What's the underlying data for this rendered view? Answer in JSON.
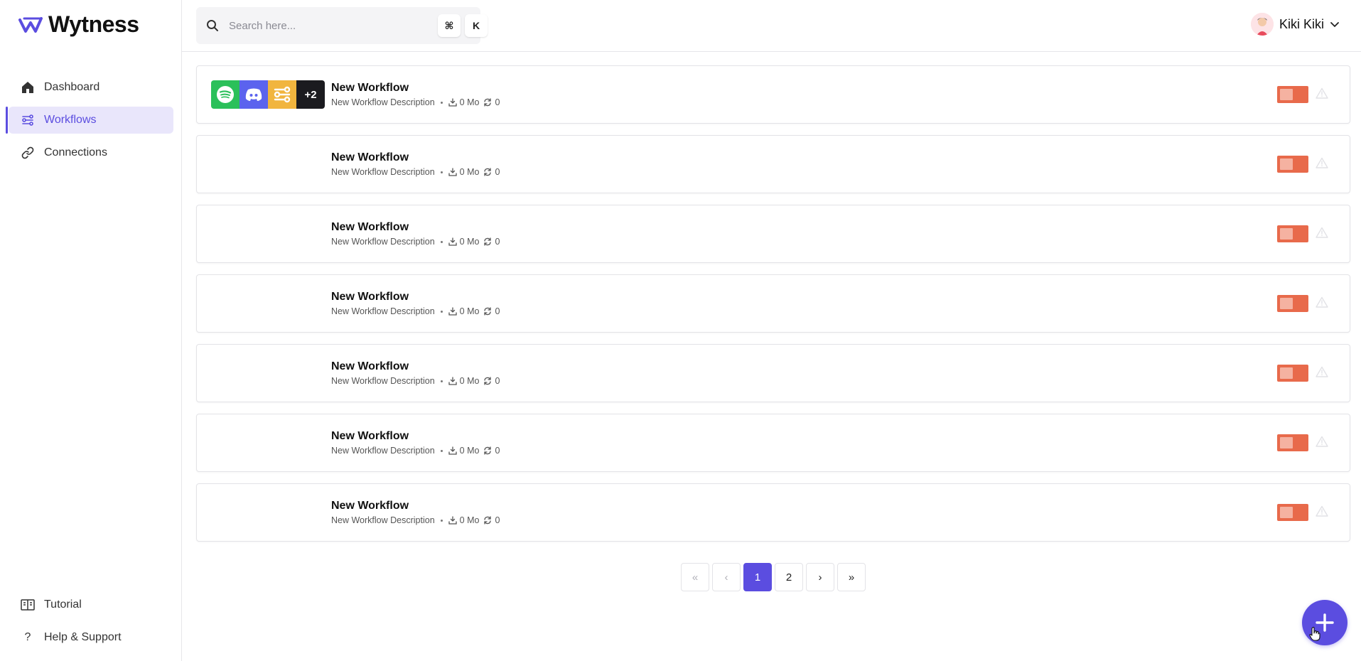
{
  "brand": {
    "name": "Wytness",
    "accent": "#5b4de0"
  },
  "sidebar": {
    "items": [
      {
        "label": "Dashboard",
        "icon": "home-icon",
        "active": false
      },
      {
        "label": "Workflows",
        "icon": "workflow-icon",
        "active": true
      },
      {
        "label": "Connections",
        "icon": "link-icon",
        "active": false
      }
    ],
    "bottom": [
      {
        "label": "Tutorial",
        "icon": "book-icon"
      },
      {
        "label": "Help & Support",
        "icon": "question-icon"
      }
    ]
  },
  "search": {
    "placeholder": "Search here...",
    "shortcut_cmd": "⌘",
    "shortcut_key": "K"
  },
  "user": {
    "name": "Kiki Kiki"
  },
  "workflows": [
    {
      "title": "New Workflow",
      "description": "New Workflow Description",
      "size": "0 Mo",
      "runs": "0",
      "apps": [
        "spotify-icon",
        "discord-icon",
        "workflow-icon"
      ],
      "more": "+2"
    },
    {
      "title": "New Workflow",
      "description": "New Workflow Description",
      "size": "0 Mo",
      "runs": "0"
    },
    {
      "title": "New Workflow",
      "description": "New Workflow Description",
      "size": "0 Mo",
      "runs": "0"
    },
    {
      "title": "New Workflow",
      "description": "New Workflow Description",
      "size": "0 Mo",
      "runs": "0"
    },
    {
      "title": "New Workflow",
      "description": "New Workflow Description",
      "size": "0 Mo",
      "runs": "0"
    },
    {
      "title": "New Workflow",
      "description": "New Workflow Description",
      "size": "0 Mo",
      "runs": "0"
    },
    {
      "title": "New Workflow",
      "description": "New Workflow Description",
      "size": "0 Mo",
      "runs": "0"
    }
  ],
  "pagination": {
    "first": "«",
    "prev": "‹",
    "pages": [
      "1",
      "2"
    ],
    "current": "1",
    "next": "›",
    "last": "»"
  },
  "colors": {
    "toggle": "#e86a4b",
    "toggle_knob": "#f5b2a1",
    "spotify": "#2bc05a",
    "discord": "#5b63ee",
    "flow": "#f1b53e"
  }
}
